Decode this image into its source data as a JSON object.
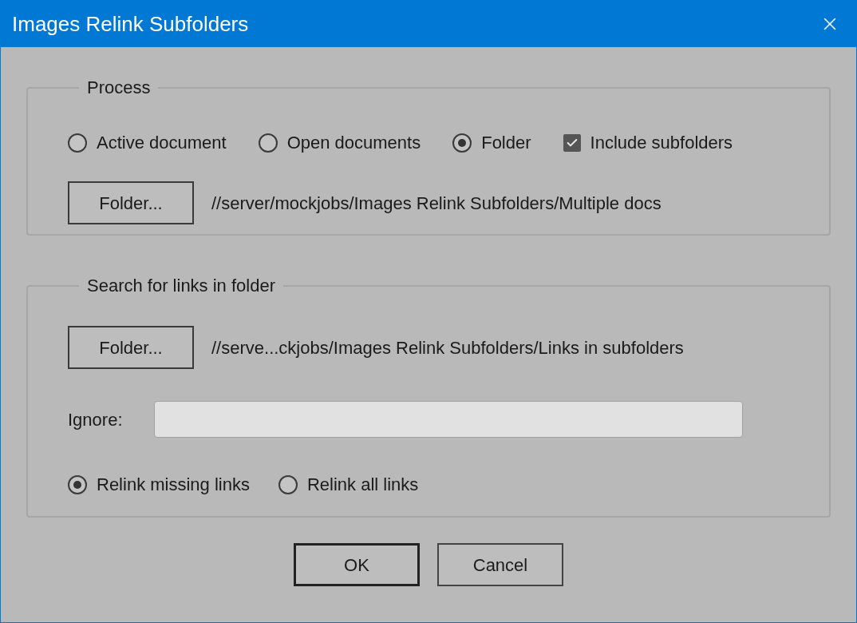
{
  "window": {
    "title": "Images Relink Subfolders"
  },
  "process": {
    "label": "Process",
    "options": [
      {
        "label": "Active document",
        "kind": "radio",
        "selected": false
      },
      {
        "label": "Open documents",
        "kind": "radio",
        "selected": false
      },
      {
        "label": "Folder",
        "kind": "radio",
        "selected": true
      },
      {
        "label": "Include subfolders",
        "kind": "checkbox",
        "checked": true
      }
    ],
    "folder_button": "Folder...",
    "path": "//server/mockjobs/Images Relink Subfolders/Multiple docs"
  },
  "search": {
    "label": "Search for links in folder",
    "folder_button": "Folder...",
    "path": "//serve...ckjobs/Images Relink Subfolders/Links in subfolders",
    "ignore": {
      "label": "Ignore:"
    },
    "relink_options": [
      {
        "label": "Relink missing links",
        "selected": true
      },
      {
        "label": "Relink all links",
        "selected": false
      }
    ]
  },
  "buttons": [
    {
      "label": "OK",
      "default": true
    },
    {
      "label": "Cancel",
      "default": false
    }
  ]
}
